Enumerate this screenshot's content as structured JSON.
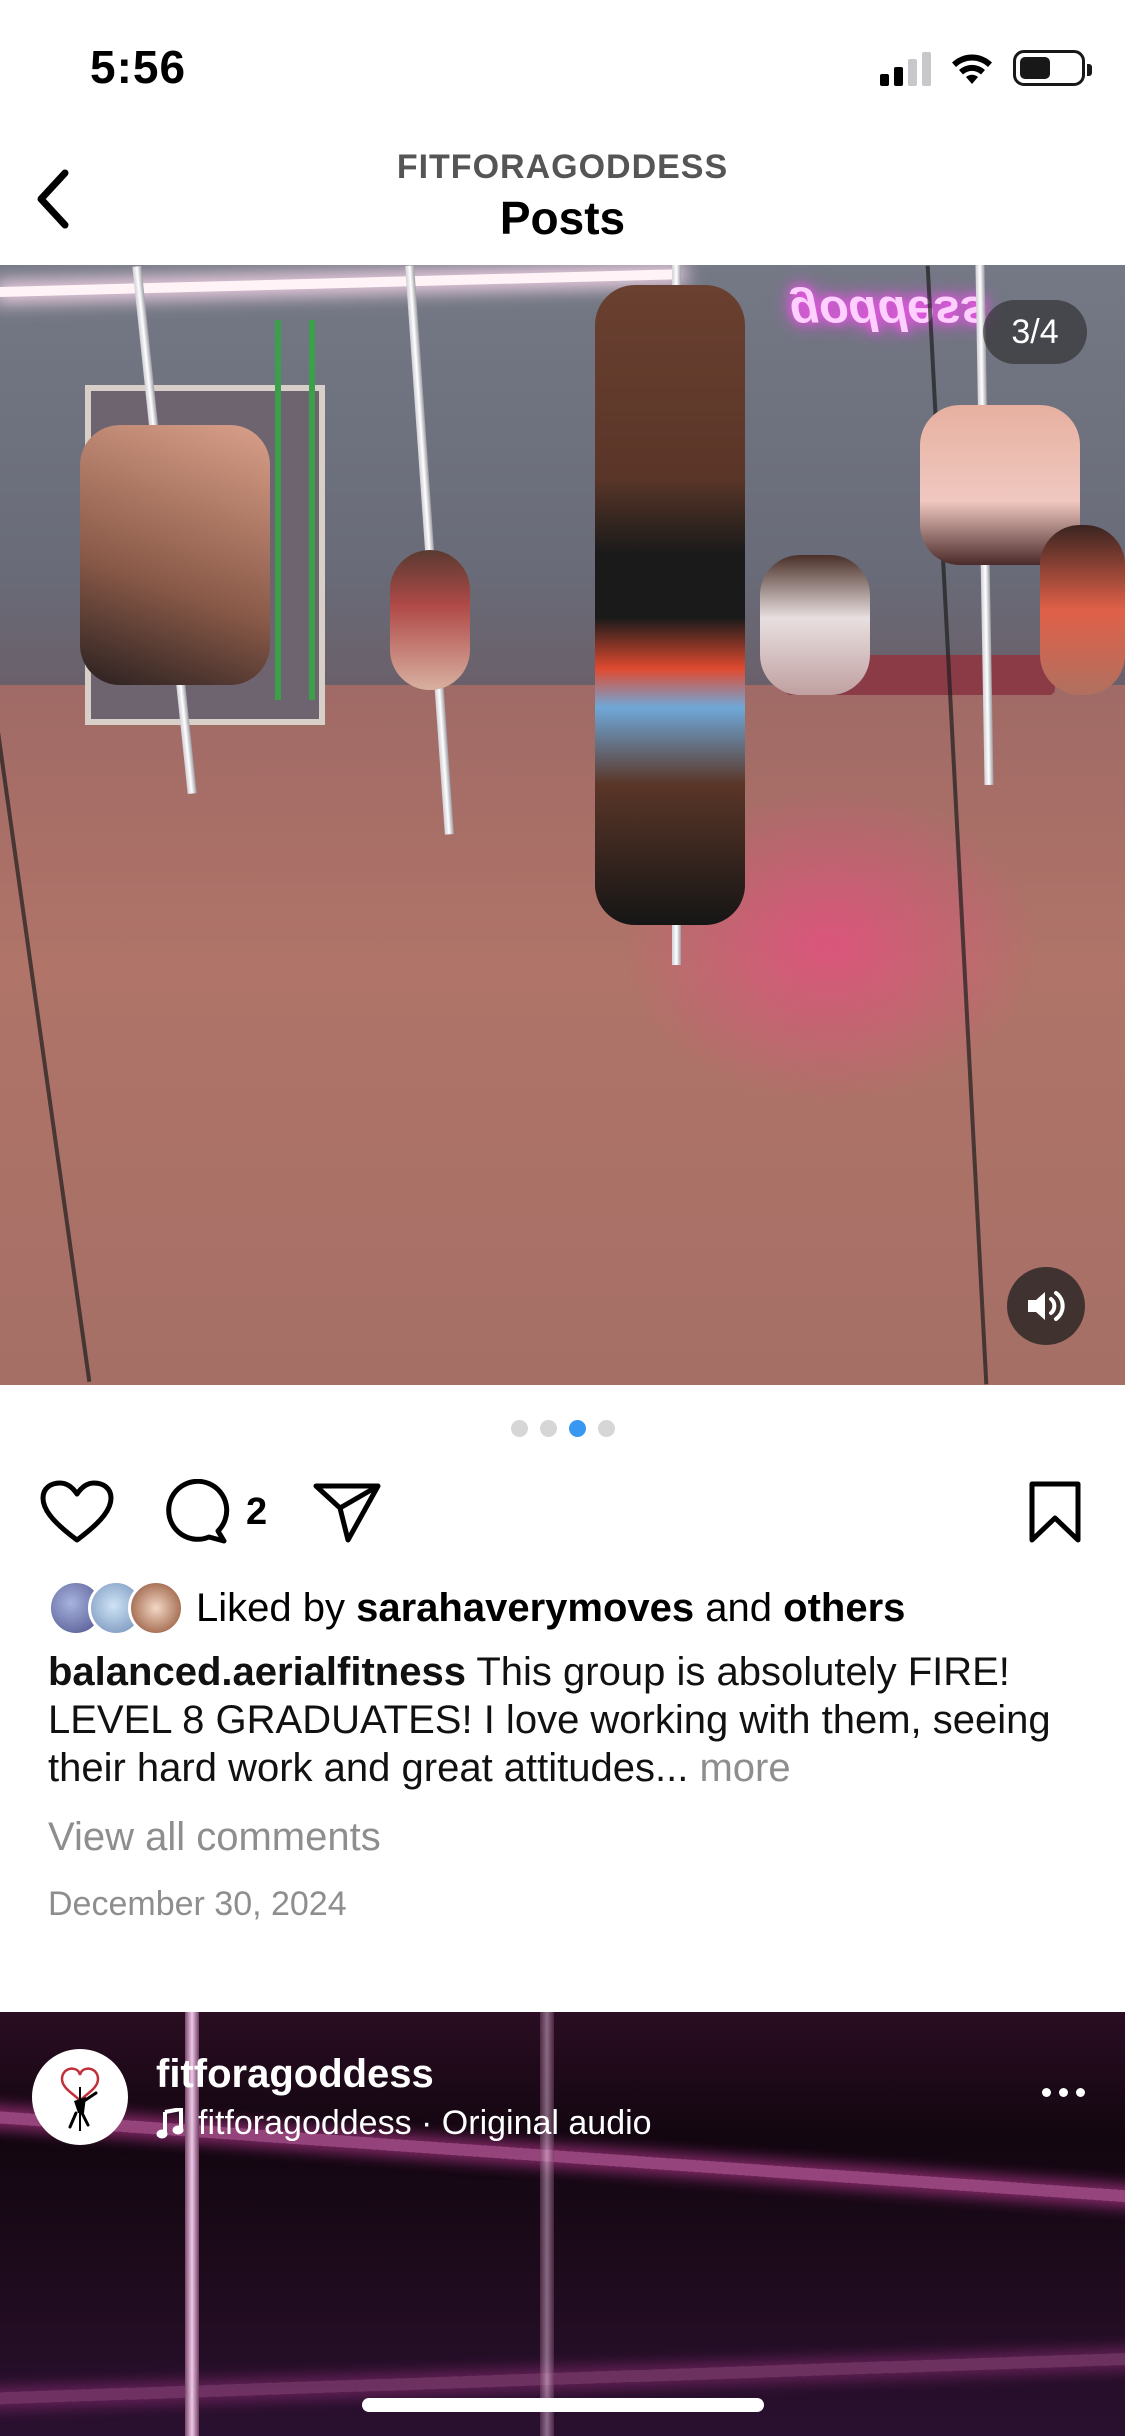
{
  "status_bar": {
    "time": "5:56",
    "battery_level": 0.45
  },
  "header": {
    "subtitle": "FITFORAGODDESS",
    "title": "Posts"
  },
  "post": {
    "page_counter": "3/4",
    "neon_sign": "goddess",
    "carousel": {
      "count": 4,
      "active_index": 2
    },
    "comment_count": "2",
    "liked_by_prefix": "Liked by",
    "liked_by_user": "sarahaverymoves",
    "liked_by_and": "and",
    "liked_by_others": "others",
    "caption_user": "balanced.aerialfitness",
    "caption_text": "This group is absolutely FIRE! LEVEL 8 GRADUATES! I love working with them, seeing their hard work and great attitudes...",
    "more_label": "more",
    "view_comments": "View all comments",
    "date": "December 30, 2024"
  },
  "next_post": {
    "username": "fitforagoddess",
    "audio": "fitforagoddess · Original audio"
  },
  "colors": {
    "active_dot": "#3897f0",
    "inactive_dot": "#d6d6d6",
    "muted_text": "#8e8e8e"
  },
  "icons": [
    "back-chevron-icon",
    "heart-icon",
    "comment-icon",
    "share-icon",
    "bookmark-icon",
    "sound-icon",
    "music-note-icon",
    "more-dots-icon"
  ]
}
